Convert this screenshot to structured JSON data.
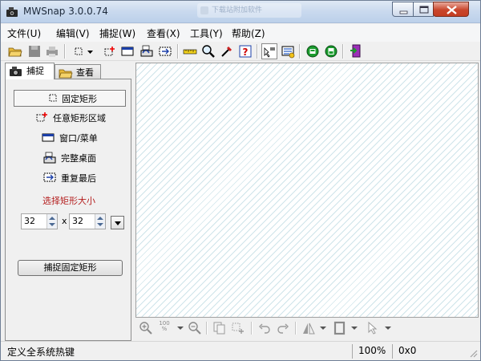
{
  "window": {
    "title": "MWSnap 3.0.0.74",
    "background_tab_text": "下载站附加软件"
  },
  "menu": [
    "文件(U)",
    "编辑(V)",
    "捕捉(W)",
    "查看(X)",
    "工具(Y)",
    "帮助(Z)"
  ],
  "toolbar_icons": [
    "open-folder-icon",
    "save-icon",
    "print-icon",
    "fixed-rect-icon",
    "chevron-down-icon",
    "any-rect-icon",
    "window-icon",
    "desktop-icon",
    "repeat-last-icon",
    "ruler-icon",
    "magnifier-icon",
    "color-picker-icon",
    "help-icon",
    "hotkeys-icon",
    "settings-icon",
    "record-icon",
    "record2-icon",
    "exit-icon"
  ],
  "tabs": {
    "capture": "捕捉",
    "view": "查看"
  },
  "capture_options": [
    {
      "label": "固定矩形",
      "icon": "fixed-rect-icon",
      "selected": true
    },
    {
      "label": "任意矩形区域",
      "icon": "any-rect-icon",
      "selected": false
    },
    {
      "label": "窗口/菜单",
      "icon": "window-menu-icon",
      "selected": false
    },
    {
      "label": "完整桌面",
      "icon": "desktop-icon",
      "selected": false
    },
    {
      "label": "重复最后",
      "icon": "repeat-last-icon",
      "selected": false
    }
  ],
  "size": {
    "title": "选择矩形大小",
    "width": "32",
    "separator": "x",
    "height": "32"
  },
  "capture_button": "捕捉固定矩形",
  "canvas_toolbar_icons": [
    "zoom-in-icon",
    "zoom-100-icon",
    "zoom-out-icon",
    "copy-icon",
    "crop-icon",
    "undo-icon",
    "redo-icon",
    "flip-icon",
    "frame-icon",
    "pointer-icon"
  ],
  "zoom_100_label": "100\n%",
  "status": {
    "message": "定义全系统热键",
    "zoom": "100%",
    "size": "0x0"
  },
  "colors": {
    "canvas_hatch": "#cfe4ea",
    "size_title": "#b41e1e",
    "close_button": "#c9462c"
  }
}
